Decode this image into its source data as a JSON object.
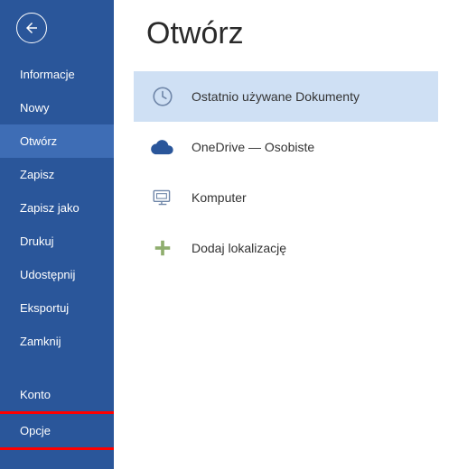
{
  "sidebar": {
    "items": [
      {
        "label": "Informacje"
      },
      {
        "label": "Nowy"
      },
      {
        "label": "Otwórz"
      },
      {
        "label": "Zapisz"
      },
      {
        "label": "Zapisz jako"
      },
      {
        "label": "Drukuj"
      },
      {
        "label": "Udostępnij"
      },
      {
        "label": "Eksportuj"
      },
      {
        "label": "Zamknij"
      },
      {
        "label": "Konto"
      },
      {
        "label": "Opcje"
      }
    ]
  },
  "main": {
    "title": "Otwórz",
    "locations": [
      {
        "label": "Ostatnio używane Dokumenty"
      },
      {
        "label": "OneDrive — Osobiste"
      },
      {
        "label": "Komputer"
      },
      {
        "label": "Dodaj lokalizację"
      }
    ]
  }
}
